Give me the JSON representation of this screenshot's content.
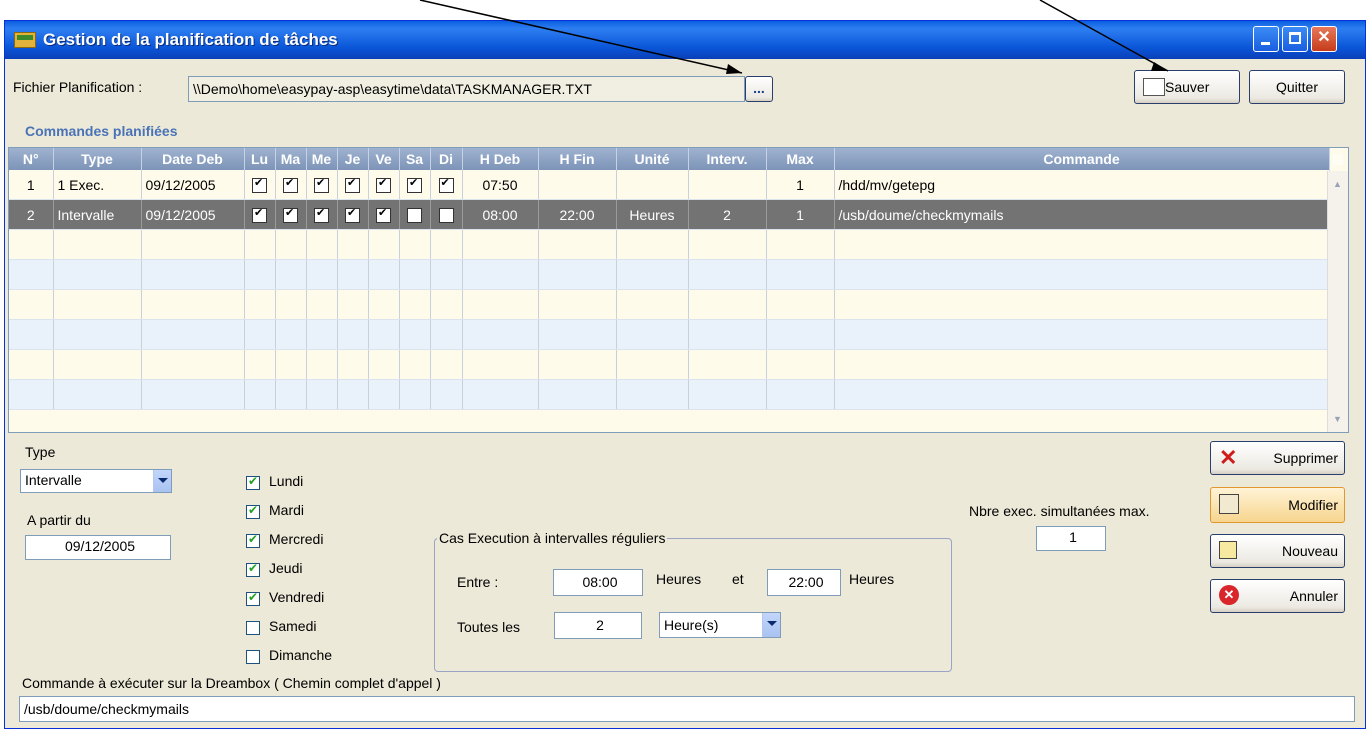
{
  "window": {
    "title": "Gestion de la planification de tâches"
  },
  "toolbar": {
    "file_label": "Fichier Planification :",
    "file_path": "\\\\Demo\\home\\easypay-asp\\easytime\\data\\TASKMANAGER.TXT",
    "browse_label": "...",
    "save_label": "Sauver",
    "quit_label": "Quitter"
  },
  "grid": {
    "section_title": "Commandes planifiées",
    "columns": [
      "N°",
      "Type",
      "Date Deb",
      "Lu",
      "Ma",
      "Me",
      "Je",
      "Ve",
      "Sa",
      "Di",
      "H Deb",
      "H Fin",
      "Unité",
      "Interv.",
      "Max",
      "Commande"
    ],
    "rows": [
      {
        "n": "1",
        "type": "1 Exec.",
        "date": "09/12/2005",
        "days": [
          true,
          true,
          true,
          true,
          true,
          true,
          true
        ],
        "hdeb": "07:50",
        "hfin": "",
        "unite": "",
        "interv": "",
        "max": "1",
        "commande": "/hdd/mv/getepg"
      },
      {
        "n": "2",
        "type": "Intervalle",
        "date": "09/12/2005",
        "days": [
          true,
          true,
          true,
          true,
          true,
          false,
          false
        ],
        "hdeb": "08:00",
        "hfin": "22:00",
        "unite": "Heures",
        "interv": "2",
        "max": "1",
        "commande": "/usb/doume/checkmymails"
      }
    ],
    "selected_row": 2
  },
  "form": {
    "type_label": "Type",
    "type_value": "Intervalle",
    "from_label": "A partir du",
    "from_value": "09/12/2005",
    "days": [
      {
        "label": "Lundi",
        "checked": true
      },
      {
        "label": "Mardi",
        "checked": true
      },
      {
        "label": "Mercredi",
        "checked": true
      },
      {
        "label": "Jeudi",
        "checked": true
      },
      {
        "label": "Vendredi",
        "checked": true
      },
      {
        "label": "Samedi",
        "checked": false
      },
      {
        "label": "Dimanche",
        "checked": false
      }
    ],
    "interval_group_label": "Cas Execution à intervalles réguliers",
    "between_label": "Entre :",
    "start_value": "08:00",
    "hours_label_1": "Heures",
    "and_label": "et",
    "end_value": "22:00",
    "hours_label_2": "Heures",
    "every_label": "Toutes les",
    "every_value": "2",
    "unit_value": "Heure(s)",
    "max_label": "Nbre exec. simultanées max.",
    "max_value": "1",
    "command_label": "Commande à exécuter sur la Dreambox ( Chemin complet d'appel )",
    "command_value": "/usb/doume/checkmymails"
  },
  "actions": {
    "delete_label": "Supprimer",
    "modify_label": "Modifier",
    "new_label": "Nouveau",
    "cancel_label": "Annuler"
  },
  "colors": {
    "title_bar": "#0a56d8",
    "selected_row": "#737373",
    "window_bg": "#ece9d8"
  }
}
